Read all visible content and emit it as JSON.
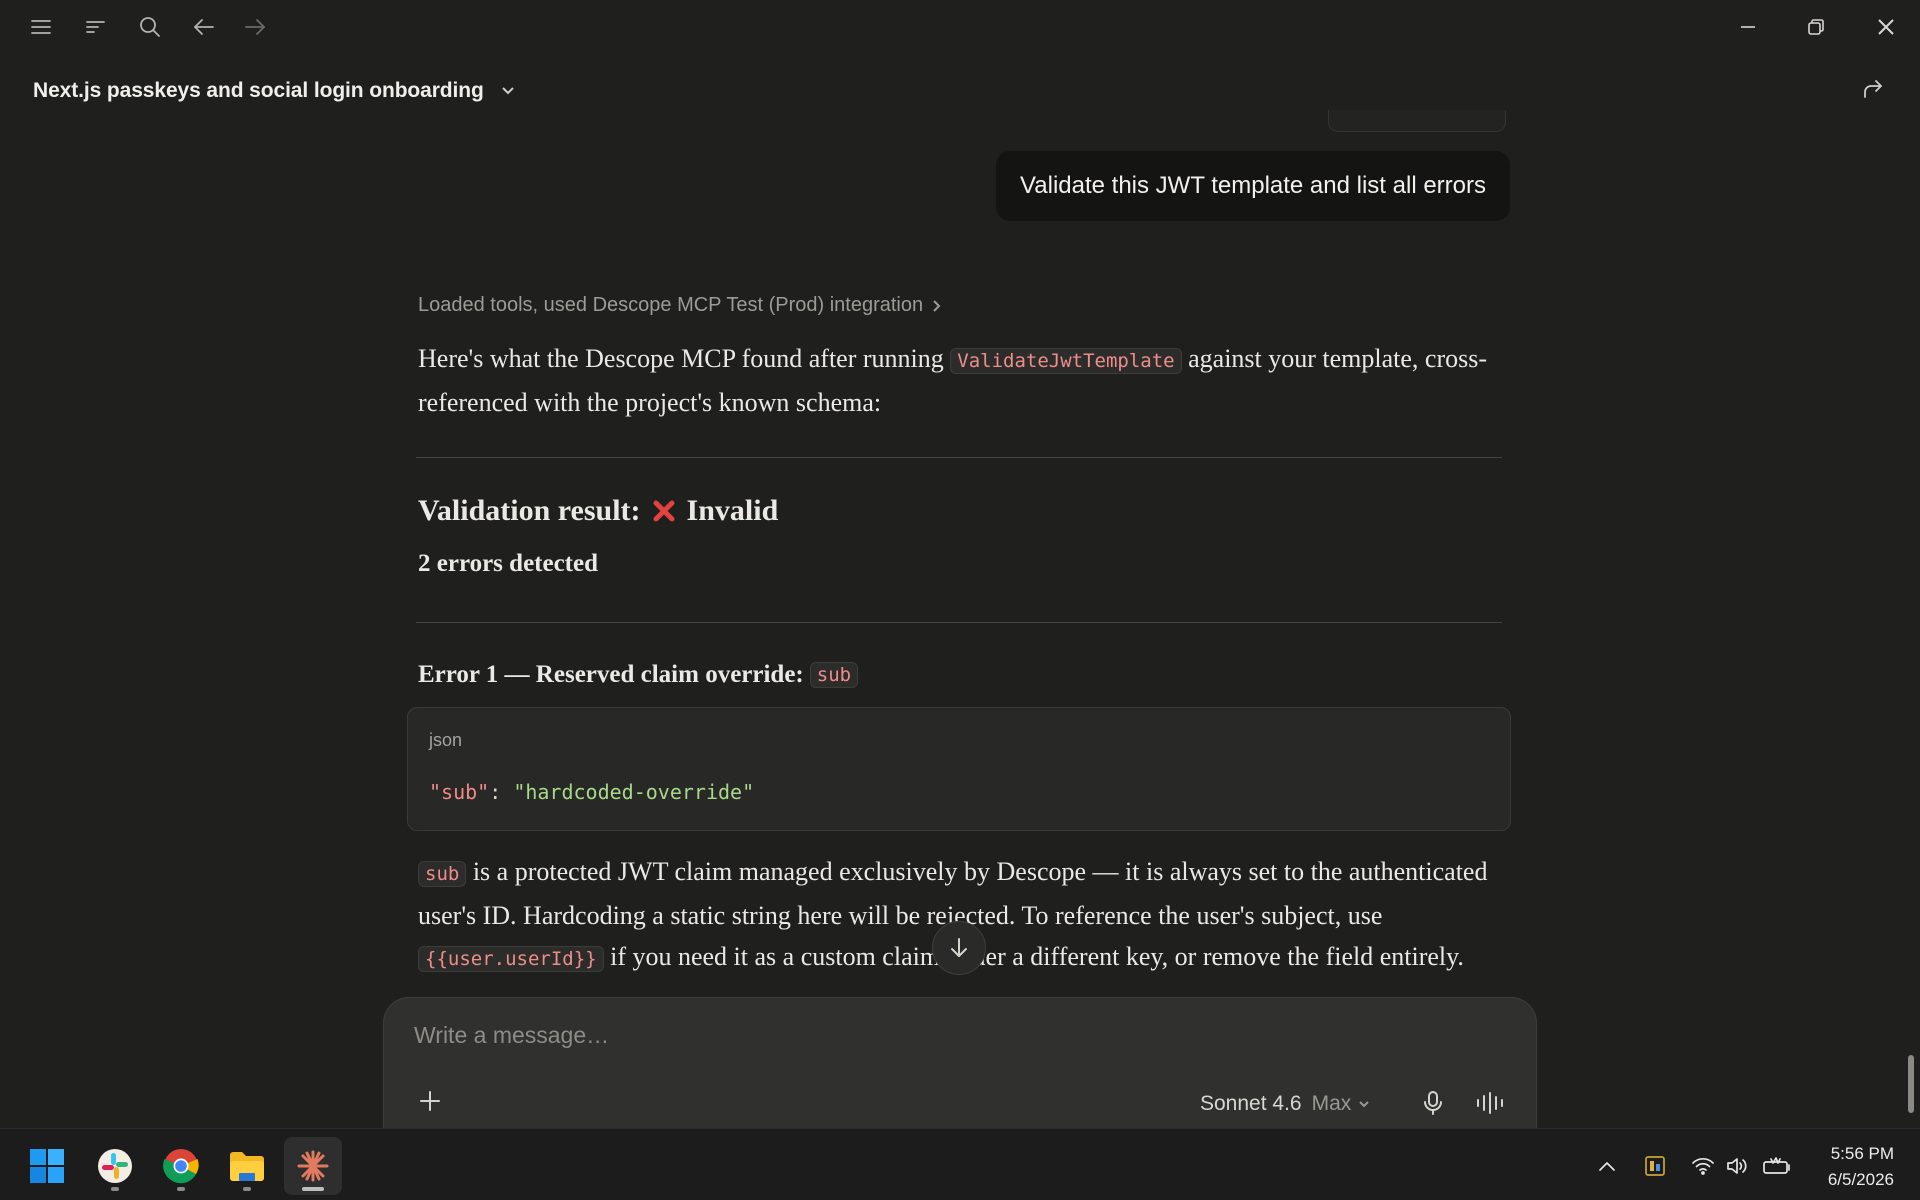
{
  "app": {
    "conversation_title": "Next.js passkeys and social login onboarding"
  },
  "chat": {
    "user_message": "Validate this JWT template and list all errors",
    "tools_summary": "Loaded tools, used Descope MCP Test (Prod) integration",
    "intro_before": "Here's what the Descope MCP found after running ",
    "intro_code": "ValidateJwtTemplate",
    "intro_after": " against your template, cross-referenced with the project's known schema:",
    "validation_label": "Validation result:",
    "validation_status": "Invalid",
    "error_count": "2 errors detected",
    "error1_heading": "Error 1 — Reserved claim override:",
    "error1_code": "sub",
    "codeblock": {
      "language": "json",
      "key": "\"sub\"",
      "colon": ": ",
      "value": "\"hardcoded-override\""
    },
    "para_code1": "sub",
    "para_text1": " is a protected JWT claim managed exclusively by Descope — it is always set to the authenticated user's ID. Hardcoding a static string here will be rejected. To reference the user's subject, use ",
    "para_code2": "{{user.userId}}",
    "para_text2": " if you need it as a custom claim under a different key, or remove the field entirely."
  },
  "composer": {
    "placeholder": "Write a message…",
    "model_name": "Sonnet 4.6",
    "model_mode": "Max"
  },
  "taskbar": {
    "time": "5:56 PM",
    "date": "6/5/2026"
  },
  "colors": {
    "background": "#1f1f1e",
    "code_inline": "#ee8d8a",
    "json_string": "#a6d98a",
    "error_x": "#e2433f"
  }
}
